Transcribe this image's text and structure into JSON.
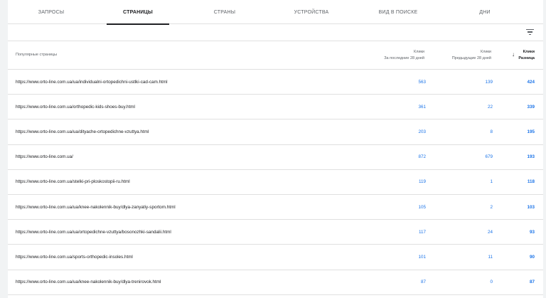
{
  "tabs": [
    {
      "label": "ЗАПРОСЫ",
      "active": false
    },
    {
      "label": "СТРАНИЦЫ",
      "active": true
    },
    {
      "label": "СТРАНЫ",
      "active": false
    },
    {
      "label": "УСТРОЙСТВА",
      "active": false
    },
    {
      "label": "ВИД В ПОИСКЕ",
      "active": false
    },
    {
      "label": "ДНИ",
      "active": false
    }
  ],
  "table": {
    "header": {
      "page": "Популярные страницы",
      "col1_title": "Клики",
      "col1_sub": "За последние 28 дней",
      "col2_title": "Клики",
      "col2_sub": "Предыдущие 28 дней",
      "col3_title": "Клики",
      "col3_sub": "Разница"
    },
    "rows": [
      {
        "url": "https://www.orto-line.com.ua/ua/individualni-ortopedichni-ustlki-cad-cam.html",
        "current": "563",
        "previous": "139",
        "diff": "424"
      },
      {
        "url": "https://www.orto-line.com.ua/orthopedic-kids-shoes-buy.html",
        "current": "361",
        "previous": "22",
        "diff": "339"
      },
      {
        "url": "https://www.orto-line.com.ua/ua/dityache-ortopedichne-vzuttya.html",
        "current": "203",
        "previous": "8",
        "diff": "195"
      },
      {
        "url": "https://www.orto-line.com.ua/",
        "current": "872",
        "previous": "679",
        "diff": "193"
      },
      {
        "url": "https://www.orto-line.com.ua/stelki-pri-ploskostopii-ru.html",
        "current": "119",
        "previous": "1",
        "diff": "118"
      },
      {
        "url": "https://www.orto-line.com.ua/ua/knee-nakolennik-buy/dlya-zanyatiy-sportom.html",
        "current": "105",
        "previous": "2",
        "diff": "103"
      },
      {
        "url": "https://www.orto-line.com.ua/ua/ortopedichne-vzuttya/bosonozhki-sandalii.html",
        "current": "117",
        "previous": "24",
        "diff": "93"
      },
      {
        "url": "https://www.orto-line.com.ua/sports-orthopedic-insoles.html",
        "current": "101",
        "previous": "11",
        "diff": "90"
      },
      {
        "url": "https://www.orto-line.com.ua/ua/knee-nakolennik-buy/dlya-trenirovok.html",
        "current": "87",
        "previous": "0",
        "diff": "87"
      }
    ]
  }
}
